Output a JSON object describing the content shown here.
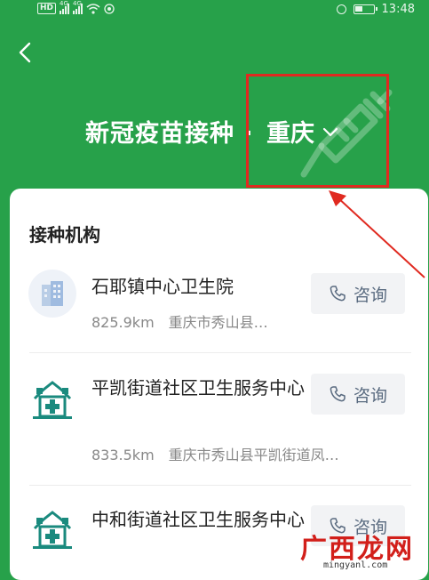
{
  "status_bar": {
    "hd": "HD",
    "network_1": "4G",
    "network_2": "4G",
    "time": "13:48"
  },
  "header": {
    "title": "新冠疫苗接种 ·",
    "city": "重庆"
  },
  "section": {
    "title": "接种机构"
  },
  "organizations": [
    {
      "name": "石耶镇中心卫生院",
      "distance": "825.9km",
      "address": "重庆市秀山县…",
      "consult_label": "咨询"
    },
    {
      "name": "平凯街道社区卫生服务中心",
      "distance": "833.5km",
      "address": "重庆市秀山县平凯街道凤…",
      "consult_label": "咨询"
    },
    {
      "name": "中和街道社区卫生服务中心",
      "distance": "",
      "address": "",
      "consult_label": "咨询"
    }
  ],
  "watermark": {
    "main": "广西龙网",
    "url": "mingyanl.com"
  },
  "colors": {
    "header_green": "#27a14a",
    "annotation_red": "#e02a20",
    "icon_teal": "#1a8a7e"
  }
}
